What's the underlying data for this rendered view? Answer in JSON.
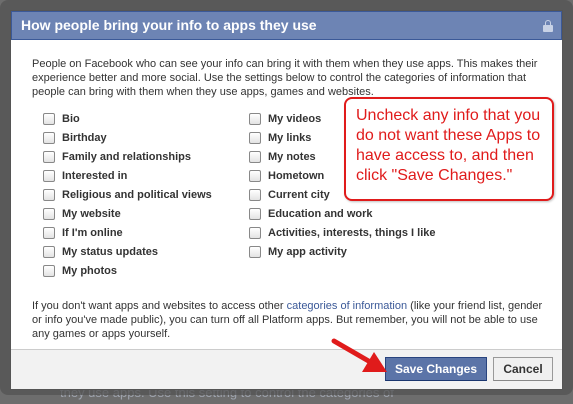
{
  "dialog": {
    "title": "How people bring your info to apps they use",
    "intro": "People on Facebook who can see your info can bring it with them when they use apps. This makes their experience better and more social. Use the settings below to control the categories of information that people can bring with them when they use apps, games and websites.",
    "options_left": [
      "Bio",
      "Birthday",
      "Family and relationships",
      "Interested in",
      "Religious and political views",
      "My website",
      "If I'm online",
      "My status updates",
      "My photos"
    ],
    "options_right": [
      "My videos",
      "My links",
      "My notes",
      "Hometown",
      "Current city",
      "Education and work",
      "Activities, interests, things I like",
      "My app activity"
    ],
    "outro_before_link": "If you don't want apps and websites to access other ",
    "outro_link": "categories of information",
    "outro_after_link": " (like your friend list, gender or info you've made public), you can turn off all Platform apps. But remember, you will not be able to use any games or apps yourself.",
    "save_label": "Save Changes",
    "cancel_label": "Cancel"
  },
  "callout": {
    "text": "Uncheck any info that you do not want these Apps to have access to, and then click \"Save Changes.\""
  },
  "background": {
    "partial_text": "they use apps. Use this setting to control the categories of"
  },
  "colors": {
    "title_bar": "#6d84b4",
    "link": "#3b5998",
    "save_button": "#5b74a8",
    "annotation_red": "#e01b1b"
  },
  "icons": {
    "title_lock": "lock-icon",
    "annotation_arrow": "arrow-icon"
  }
}
